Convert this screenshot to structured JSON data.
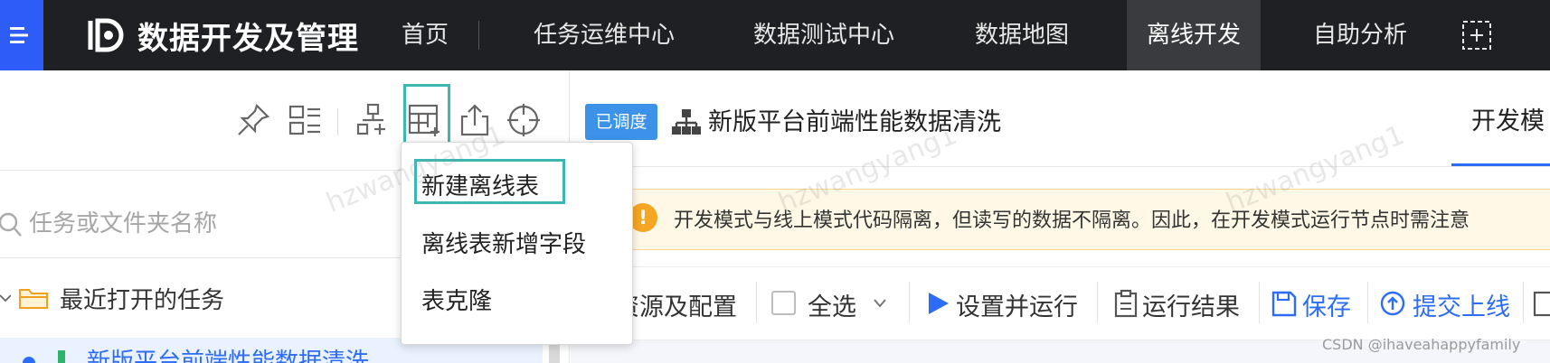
{
  "topbar": {
    "brand_name": "数据开发及管理",
    "nav": [
      {
        "label": "首页"
      },
      {
        "label": "任务运维中心"
      },
      {
        "label": "数据测试中心"
      },
      {
        "label": "数据地图"
      },
      {
        "label": "离线开发",
        "active": true
      },
      {
        "label": "自助分析"
      }
    ]
  },
  "left_panel": {
    "search_placeholder": "任务或文件夹名称",
    "recent_label": "最近打开的任务",
    "task_item": "新版平台前端性能数据清洗"
  },
  "dropdown": {
    "items": [
      "新建离线表",
      "离线表新增字段",
      "表克隆"
    ]
  },
  "task_header": {
    "tag": "已调度",
    "title": "新版平台前端性能数据清洗",
    "tab": "开发模"
  },
  "alert": {
    "icon_text": "!",
    "text": "开发模式与线上模式代码隔离，但读写的数据不隔离。因此，在开发模式运行节点时需注意"
  },
  "toolbar": {
    "resources": "资源及配置",
    "select_all": "全选",
    "run": "设置并运行",
    "results": "运行结果",
    "save": "保存",
    "submit": "提交上线"
  },
  "watermark": "hzwangyang1",
  "footer_credit": "CSDN @ihaveahappyfamily",
  "colors": {
    "topbar_bg": "#1f2023",
    "accent_blue": "#2d6df6",
    "highlight_teal": "#3db7b3",
    "alert_bg": "#fff8e6",
    "tag_blue": "#3b92e8"
  }
}
